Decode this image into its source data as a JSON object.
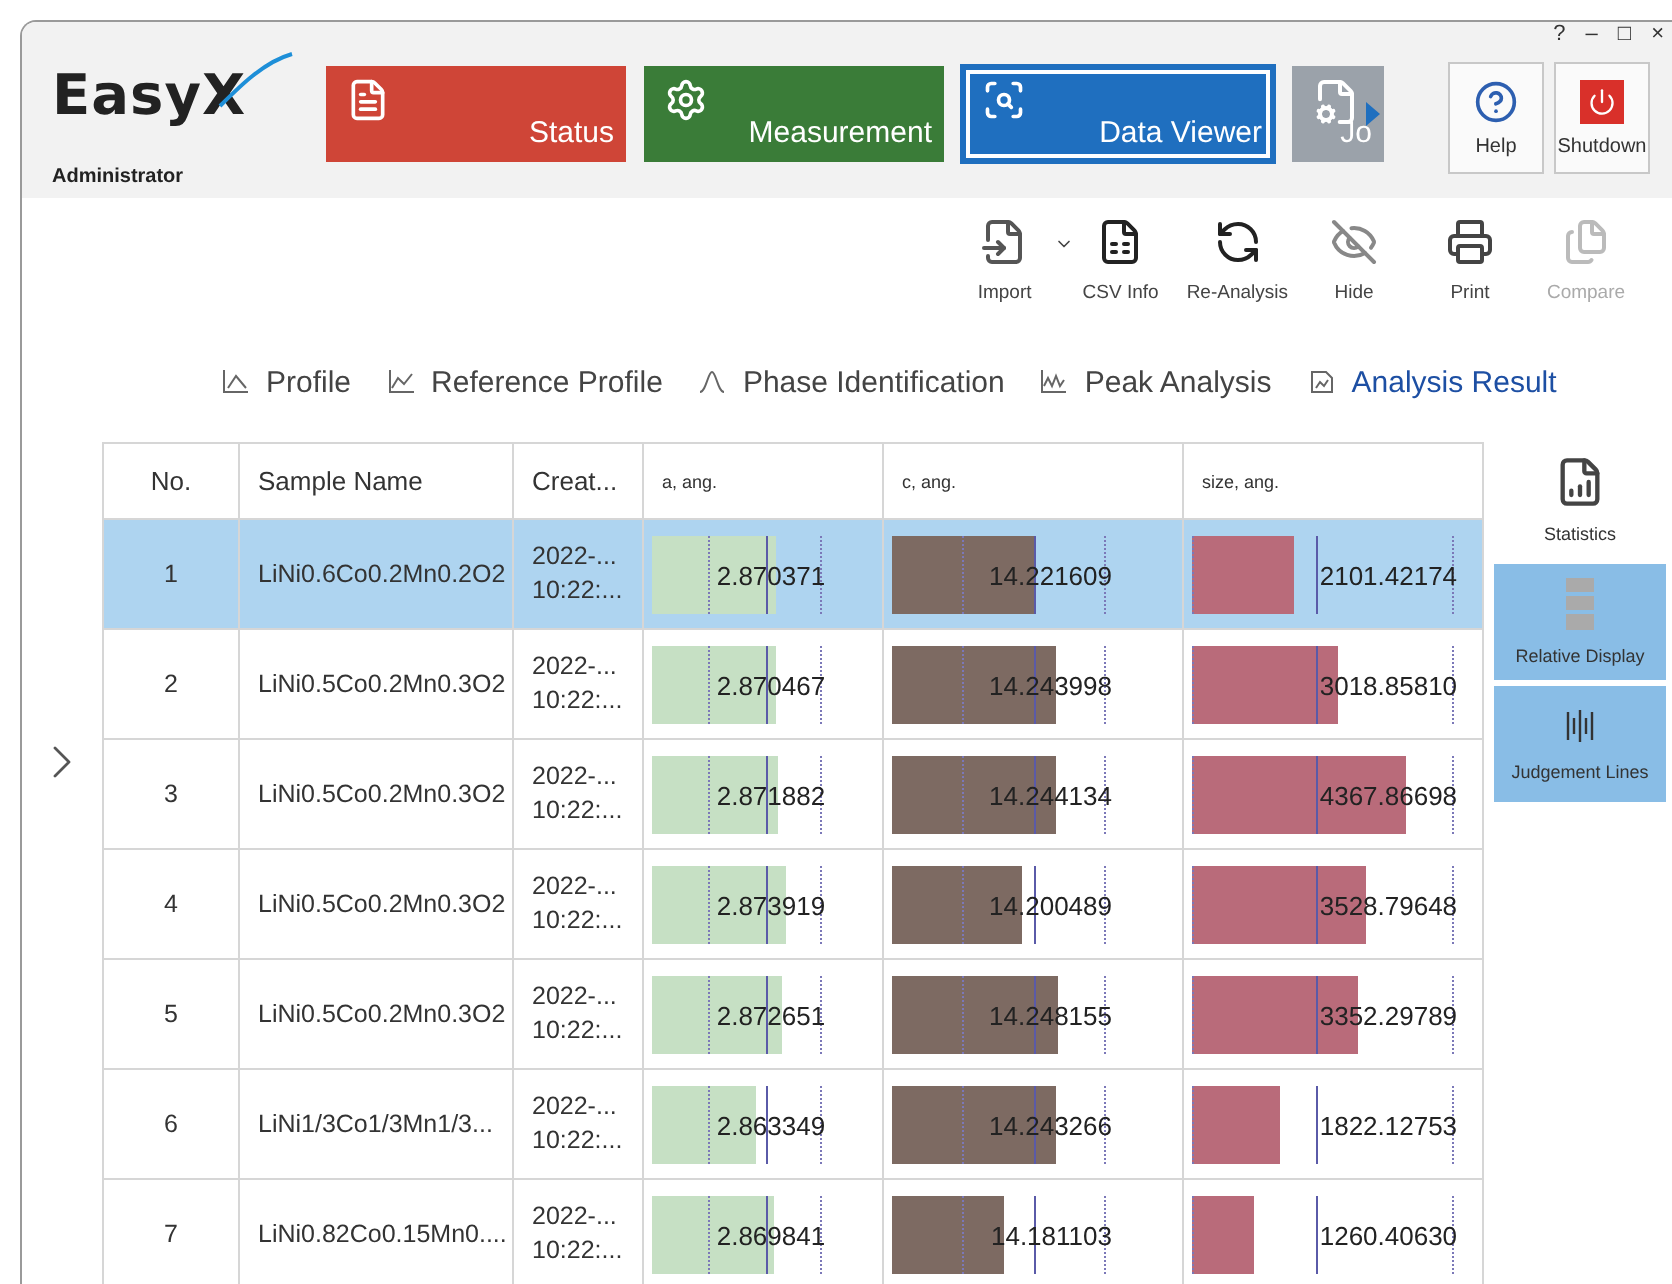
{
  "window": {
    "controls": [
      "?",
      "–",
      "□",
      "×"
    ]
  },
  "header": {
    "logo": "EasyX",
    "user": "Administrator",
    "modules": [
      {
        "label": "Status",
        "kind": "status",
        "color": "#cf4537",
        "selected": false
      },
      {
        "label": "Measurement",
        "kind": "measurement",
        "color": "#3a7c38",
        "selected": false
      },
      {
        "label": "Data Viewer",
        "kind": "viewer",
        "color": "#1f6fbf",
        "selected": true
      },
      {
        "label": "Jo",
        "kind": "job",
        "color": "#9ba2aa",
        "selected": false
      }
    ],
    "actions": [
      {
        "label": "Help",
        "kind": "help"
      },
      {
        "label": "Shutdown",
        "kind": "shutdown"
      }
    ]
  },
  "toolbar": [
    {
      "label": "Import",
      "kind": "import",
      "disabled": false
    },
    {
      "label": "CSV Info",
      "kind": "csv",
      "disabled": false
    },
    {
      "label": "Re-Analysis",
      "kind": "reanalysis",
      "disabled": false
    },
    {
      "label": "Hide",
      "kind": "hide",
      "disabled": false
    },
    {
      "label": "Print",
      "kind": "print",
      "disabled": false
    },
    {
      "label": "Compare",
      "kind": "compare",
      "disabled": true
    }
  ],
  "tabs": [
    {
      "label": "Profile",
      "selected": false
    },
    {
      "label": "Reference Profile",
      "selected": false
    },
    {
      "label": "Phase Identification",
      "selected": false
    },
    {
      "label": "Peak Analysis",
      "selected": false
    },
    {
      "label": "Analysis Result",
      "selected": true
    }
  ],
  "table": {
    "columns": [
      {
        "label": "No.",
        "kind": "center"
      },
      {
        "label": "Sample Name",
        "kind": "text"
      },
      {
        "label": "Creat...",
        "kind": "text"
      },
      {
        "label": "a, ang.",
        "kind": "bar",
        "color": "#c6e0c4"
      },
      {
        "label": "c, ang.",
        "kind": "bar",
        "color": "#7d6a62"
      },
      {
        "label": "size, ang.",
        "kind": "bar",
        "color": "#b96b7a"
      }
    ],
    "rows": [
      {
        "selected": true,
        "cells": [
          {
            "text": "1"
          },
          {
            "text": "LiNi0.6Co0.2Mn0.2O2"
          },
          {
            "text": "2022-...\n10:22:..."
          },
          {
            "text": "2.870371",
            "level": 0.56
          },
          {
            "text": "14.221609",
            "level": 0.51
          },
          {
            "text": "2101.42174",
            "level": 0.36
          }
        ]
      },
      {
        "selected": false,
        "cells": [
          {
            "text": "2"
          },
          {
            "text": "LiNi0.5Co0.2Mn0.3O2"
          },
          {
            "text": "2022-...\n10:22:..."
          },
          {
            "text": "2.870467",
            "level": 0.56
          },
          {
            "text": "14.243998",
            "level": 0.58
          },
          {
            "text": "3018.85810",
            "level": 0.52
          }
        ]
      },
      {
        "selected": false,
        "cells": [
          {
            "text": "3"
          },
          {
            "text": "LiNi0.5Co0.2Mn0.3O2"
          },
          {
            "text": "2022-...\n10:22:..."
          },
          {
            "text": "2.871882",
            "level": 0.57
          },
          {
            "text": "14.244134",
            "level": 0.58
          },
          {
            "text": "4367.86698",
            "level": 0.76
          }
        ]
      },
      {
        "selected": false,
        "cells": [
          {
            "text": "4"
          },
          {
            "text": "LiNi0.5Co0.2Mn0.3O2"
          },
          {
            "text": "2022-...\n10:22:..."
          },
          {
            "text": "2.873919",
            "level": 0.6
          },
          {
            "text": "14.200489",
            "level": 0.46
          },
          {
            "text": "3528.79648",
            "level": 0.62
          }
        ]
      },
      {
        "selected": false,
        "cells": [
          {
            "text": "5"
          },
          {
            "text": "LiNi0.5Co0.2Mn0.3O2"
          },
          {
            "text": "2022-...\n10:22:..."
          },
          {
            "text": "2.872651",
            "level": 0.59
          },
          {
            "text": "14.248155",
            "level": 0.59
          },
          {
            "text": "3352.29789",
            "level": 0.59
          }
        ]
      },
      {
        "selected": false,
        "cells": [
          {
            "text": "6"
          },
          {
            "text": "LiNi1/3Co1/3Mn1/3..."
          },
          {
            "text": "2022-...\n10:22:..."
          },
          {
            "text": "2.863349",
            "level": 0.47
          },
          {
            "text": "14.243266",
            "level": 0.58
          },
          {
            "text": "1822.12753",
            "level": 0.31
          }
        ]
      },
      {
        "selected": false,
        "cells": [
          {
            "text": "7"
          },
          {
            "text": "LiNi0.82Co0.15Mn0...."
          },
          {
            "text": "2022-...\n10:22:..."
          },
          {
            "text": "2.869841",
            "level": 0.55
          },
          {
            "text": "14.181103",
            "level": 0.4
          },
          {
            "text": "1260.40630",
            "level": 0.22
          }
        ]
      }
    ]
  },
  "side_panel": [
    {
      "label": "Statistics",
      "kind": "statistics",
      "on": false
    },
    {
      "label": "Relative Display",
      "kind": "relative",
      "on": true
    },
    {
      "label": "Judgement Lines",
      "kind": "judgement",
      "on": true
    }
  ]
}
